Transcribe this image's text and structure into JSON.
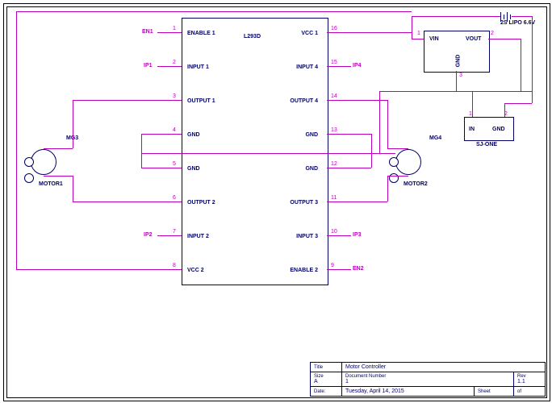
{
  "chip_main": {
    "name": "L293D",
    "left_pins": [
      {
        "num": "1",
        "label": "ENABLE 1",
        "net": "EN1"
      },
      {
        "num": "2",
        "label": "INPUT 1",
        "net": "IP1"
      },
      {
        "num": "3",
        "label": "OUTPUT 1",
        "net": ""
      },
      {
        "num": "4",
        "label": "GND",
        "net": ""
      },
      {
        "num": "5",
        "label": "GND",
        "net": ""
      },
      {
        "num": "6",
        "label": "OUTPUT 2",
        "net": ""
      },
      {
        "num": "7",
        "label": "INPUT 2",
        "net": "IP2"
      },
      {
        "num": "8",
        "label": "VCC 2",
        "net": ""
      }
    ],
    "right_pins": [
      {
        "num": "16",
        "label": "VCC 1",
        "net": ""
      },
      {
        "num": "15",
        "label": "INPUT 4",
        "net": "IP4"
      },
      {
        "num": "14",
        "label": "OUTPUT 4",
        "net": ""
      },
      {
        "num": "13",
        "label": "GND",
        "net": ""
      },
      {
        "num": "12",
        "label": "GND",
        "net": ""
      },
      {
        "num": "11",
        "label": "OUTPUT 3",
        "net": ""
      },
      {
        "num": "10",
        "label": "INPUT 3",
        "net": "IP3"
      },
      {
        "num": "9",
        "label": "ENABLE 2",
        "net": "EN2"
      }
    ]
  },
  "chip_reg": {
    "pins": {
      "vin": "VIN",
      "vout": "VOUT",
      "gnd": "GND"
    },
    "num_vin": "1",
    "num_vout": "2",
    "num_gnd": "3"
  },
  "chip_sj": {
    "name": "SJ-ONE",
    "in": "IN",
    "gnd": "GND",
    "num_in": "1",
    "num_gnd": "2"
  },
  "motors": {
    "m1": {
      "ref": "MG3",
      "name": "MOTOR1"
    },
    "m2": {
      "ref": "MG4",
      "name": "MOTOR2"
    }
  },
  "battery": {
    "name": "2S LIPO 6.6V"
  },
  "title_block": {
    "title_label": "Title",
    "title": "Motor Controller",
    "size_label": "Size",
    "size": "A",
    "doc_label": "Document Number",
    "doc": "1",
    "rev_label": "Rev",
    "rev": "1.1",
    "date_label": "Date:",
    "date": "Tuesday, April 14, 2015",
    "sheet_label": "Sheet",
    "of": "of"
  }
}
